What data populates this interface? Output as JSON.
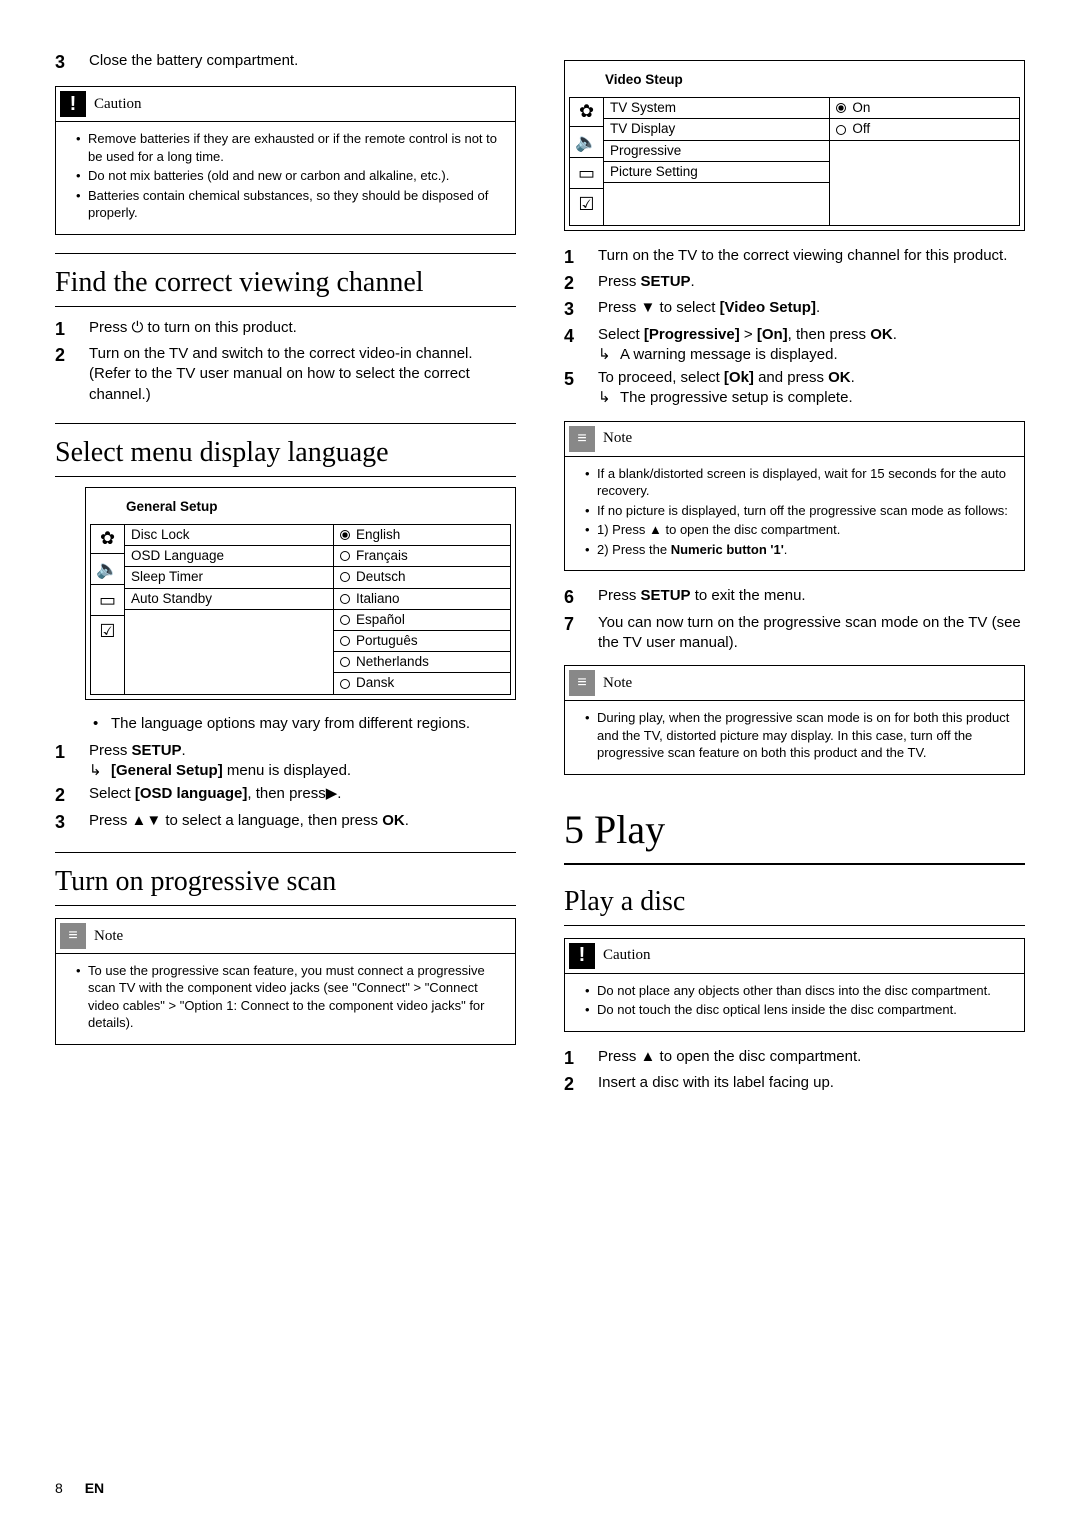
{
  "left": {
    "step3": {
      "n": "3",
      "text": "Close the battery compartment."
    },
    "caution1": {
      "label": "Caution",
      "items": [
        "Remove batteries if they are exhausted or if the remote control is not to be used for a long time.",
        "Do not mix batteries (old and new or carbon and alkaline, etc.).",
        "Batteries contain chemical substances, so they should be disposed of properly."
      ]
    },
    "sec_find": {
      "title": "Find the correct viewing channel",
      "s1n": "1",
      "s1": "Press ⏻ to turn on this product.",
      "s2n": "2",
      "s2": "Turn on the TV and switch to the correct video-in channel. (Refer to the TV user manual on how to select the correct channel.)"
    },
    "sec_lang": {
      "title": "Select menu display language",
      "osd_title": "General Setup",
      "left_items": [
        "Disc Lock",
        "OSD Language",
        "Sleep Timer",
        "Auto Standby"
      ],
      "right_items": [
        "English",
        "Français",
        "Deutsch",
        "Italiano",
        "Español",
        "Português",
        "Netherlands",
        "Dansk"
      ],
      "sel_index": 0,
      "note_bullet": "The language options may vary from different regions.",
      "s1n": "1",
      "s1a": "Press ",
      "s1b": "SETUP",
      "s1c": ".",
      "s1_sub_a": "[General Setup]",
      "s1_sub_b": " menu is displayed.",
      "s2n": "2",
      "s2a": "Select ",
      "s2b": "[OSD language]",
      "s2c": ", then press▶.",
      "s3n": "3",
      "s3a": "Press ▲▼ to select a language, then press ",
      "s3b": "OK",
      "s3c": "."
    },
    "sec_prog": {
      "title": "Turn on progressive scan",
      "note_label": "Note",
      "note_items": [
        "To use the progressive scan feature, you must connect a progressive scan TV with the component video jacks (see \"Connect\" > \"Connect video cables\" > \"Option 1: Connect to the component video jacks\" for details)."
      ]
    }
  },
  "right": {
    "osd": {
      "title": "Video Steup",
      "left_items": [
        "TV System",
        "TV Display",
        "Progressive",
        "Picture Setting"
      ],
      "right_items": [
        "On",
        "Off"
      ],
      "sel_index": 0
    },
    "s1n": "1",
    "s1": "Turn on the TV to the correct viewing channel for this product.",
    "s2n": "2",
    "s2a": "Press ",
    "s2b": "SETUP",
    "s2c": ".",
    "s3n": "3",
    "s3a": "Press ▼ to select ",
    "s3b": "[Video Setup]",
    "s3c": ".",
    "s4n": "4",
    "s4a": "Select ",
    "s4b": "[Progressive]",
    "s4c": " > ",
    "s4d": "[On]",
    "s4e": ", then press ",
    "s4f": "OK",
    "s4g": ".",
    "s4_sub": "A warning message is displayed.",
    "s5n": "5",
    "s5a": "To proceed, select ",
    "s5b": "[Ok]",
    "s5c": " and press ",
    "s5d": "OK",
    "s5e": ".",
    "s5_sub": "The progressive setup is complete.",
    "note1": {
      "label": "Note",
      "items": [
        "If a blank/distorted screen is displayed, wait for 15 seconds for the auto recovery.",
        "If no picture is displayed, turn off the progressive scan mode as follows:",
        "1) Press ▲ to open the disc compartment.",
        "2) Press the Numeric button '1'."
      ],
      "bold_frag": "Numeric button '1'"
    },
    "s6n": "6",
    "s6a": "Press ",
    "s6b": "SETUP",
    "s6c": " to exit the menu.",
    "s7n": "7",
    "s7": "You can now turn on the progressive scan mode on the TV (see the TV user manual).",
    "note2": {
      "label": "Note",
      "items": [
        "During play, when the progressive scan mode is on for both this product and the TV, distorted picture may display. In this case, turn off the progressive scan feature on both this product and the TV."
      ]
    },
    "chapter": "5   Play",
    "sec_playdisc": {
      "title": "Play a disc",
      "caution_label": "Caution",
      "caution_items": [
        "Do not place any objects other than discs into the disc compartment.",
        "Do not touch the disc optical lens inside the disc compartment."
      ],
      "s1n": "1",
      "s1": "Press ▲ to open the disc compartment.",
      "s2n": "2",
      "s2": "Insert a disc with its label facing up."
    }
  },
  "footer": {
    "page": "8",
    "lang": "EN"
  }
}
